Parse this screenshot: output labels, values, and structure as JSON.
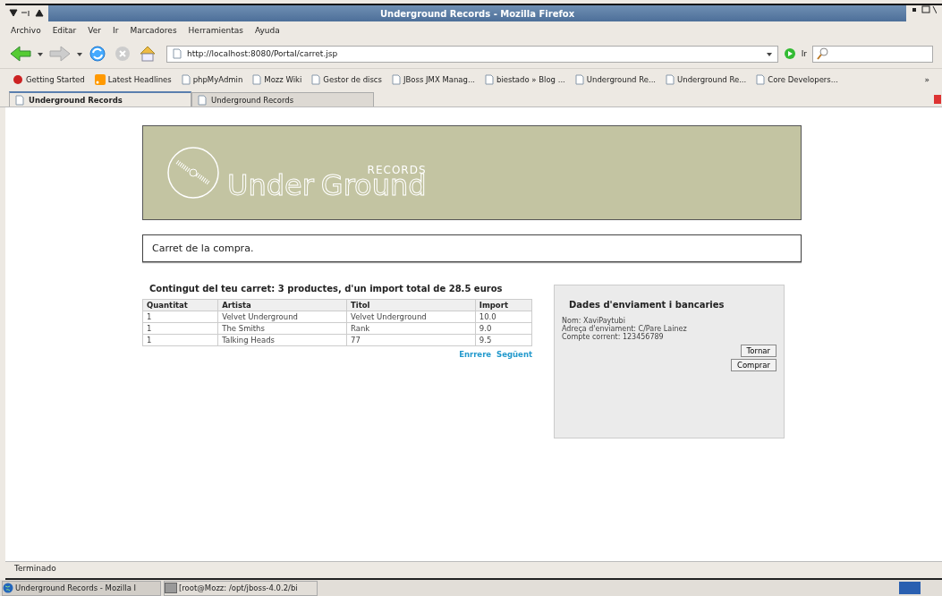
{
  "window": {
    "title": "Underground Records - Mozilla Firefox"
  },
  "menu": [
    "Archivo",
    "Editar",
    "Ver",
    "Ir",
    "Marcadores",
    "Herramientas",
    "Ayuda"
  ],
  "address": {
    "value": "http://localhost:8080/Portal/carret.jsp",
    "go_label": "Ir"
  },
  "bookmarks": [
    {
      "label": "Getting Started",
      "kind": "start"
    },
    {
      "label": "Latest Headlines",
      "kind": "rss"
    },
    {
      "label": "phpMyAdmin",
      "kind": "page"
    },
    {
      "label": "Mozz Wiki",
      "kind": "page"
    },
    {
      "label": "Gestor de discs",
      "kind": "page"
    },
    {
      "label": "JBoss JMX Manag...",
      "kind": "page"
    },
    {
      "label": "biestado » Blog ...",
      "kind": "page"
    },
    {
      "label": "Underground Re...",
      "kind": "page"
    },
    {
      "label": "Underground Re...",
      "kind": "page"
    },
    {
      "label": "Core Developers...",
      "kind": "page"
    }
  ],
  "bookmarks_more": "»",
  "tabs": [
    {
      "label": "Underground Records",
      "selected": true
    },
    {
      "label": "Underground Records",
      "selected": false
    }
  ],
  "page": {
    "logo": {
      "main_left": "Under",
      "main_right": "Ground",
      "sub": "RECORDS"
    },
    "heading": "Carret de la compra.",
    "summary": "Contingut del teu carret: 3 productes, d'un import total de 28.5 euros",
    "table": {
      "columns": [
        "Quantitat",
        "Artista",
        "Titol",
        "Import"
      ],
      "rows": [
        [
          "1",
          "Velvet Underground",
          "Velvet Underground",
          "10.0"
        ],
        [
          "1",
          "The Smiths",
          "Rank",
          "9.0"
        ],
        [
          "1",
          "Talking Heads",
          "77",
          "9.5"
        ]
      ]
    },
    "links": [
      "Enrrere",
      "Següent"
    ],
    "shipping": {
      "title": "Dades d'enviament i bancaries",
      "lines": [
        "Nom: XaviPaytubi",
        "Adreça d'enviament: C/Pare Lainez",
        "Compte corrent: 123456789"
      ],
      "buttons": [
        "Tornar",
        "Comprar"
      ]
    }
  },
  "status_bar": "Terminado",
  "taskbar": [
    {
      "label": "Underground Records - Mozilla I",
      "kind": "browser",
      "selected": true
    },
    {
      "label": "[root@Mozz: /opt/jboss-4.0.2/bi",
      "kind": "terminal",
      "selected": false
    }
  ]
}
